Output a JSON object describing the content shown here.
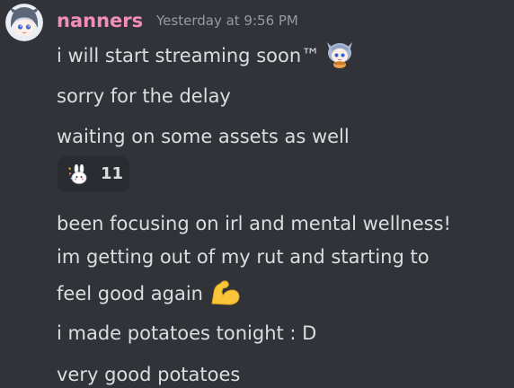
{
  "author": {
    "name": "nanners",
    "timestamp": "Yesterday at 9:56 PM",
    "name_color": "#f28fb7"
  },
  "messages": [
    {
      "text": "i will start streaming soon™",
      "emoji": "chibi-streamer-emoji"
    },
    {
      "text": "sorry for the delay"
    },
    {
      "text": "waiting on some assets as well"
    },
    {
      "text": "been focusing on irl and mental wellness!"
    },
    {
      "text": "im getting out of my rut and starting to"
    },
    {
      "text": "feel good again",
      "emoji": "flexed-biceps-emoji"
    },
    {
      "text": "i made potatoes tonight : D"
    },
    {
      "text": "very good potatoes"
    }
  ],
  "reaction": {
    "emoji": "bunny-sparkle-emoji",
    "count": "11"
  },
  "colors": {
    "background": "#323339",
    "text": "#dbdee1",
    "muted": "#959ba4",
    "reaction_bg": "#2b2c31"
  }
}
